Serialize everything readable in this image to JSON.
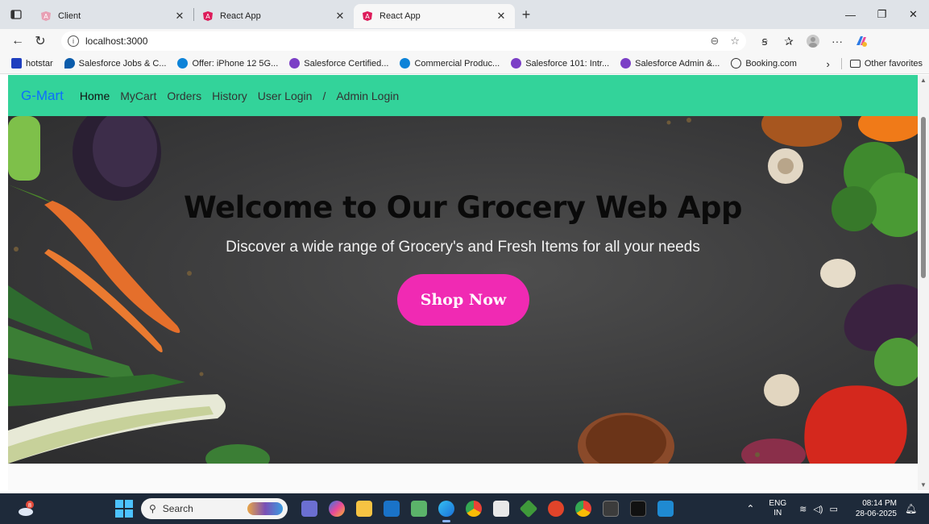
{
  "browser": {
    "tabs": [
      {
        "title": "Client",
        "active": false
      },
      {
        "title": "React App",
        "active": false
      },
      {
        "title": "React App",
        "active": true
      }
    ],
    "url": "localhost:3000",
    "bookmarks": [
      "hotstar",
      "Salesforce Jobs & C...",
      "Offer: iPhone 12 5G...",
      "Salesforce Certified...",
      "Commercial Produc...",
      "Salesforce 101: Intr...",
      "Salesforce Admin &...",
      "Booking.com"
    ],
    "other_favorites": "Other favorites"
  },
  "site": {
    "brand": "G-Mart",
    "nav": {
      "home": "Home",
      "mycart": "MyCart",
      "orders": "Orders",
      "history": "History",
      "user_login": "User Login",
      "separator": "/",
      "admin_login": "Admin Login"
    },
    "hero": {
      "title": "Welcome to Our Grocery Web App",
      "subtitle": "Discover a wide range of Grocery's and Fresh Items for all your needs",
      "cta": "Shop Now"
    },
    "colors": {
      "navbar": "#33d39a",
      "brand": "#0d6efd",
      "cta": "#f02ab3"
    }
  },
  "taskbar": {
    "search_placeholder": "Search",
    "weather_badge": "8",
    "lang_line1": "ENG",
    "lang_line2": "IN",
    "time": "08:14 PM",
    "date": "28-06-2025"
  }
}
